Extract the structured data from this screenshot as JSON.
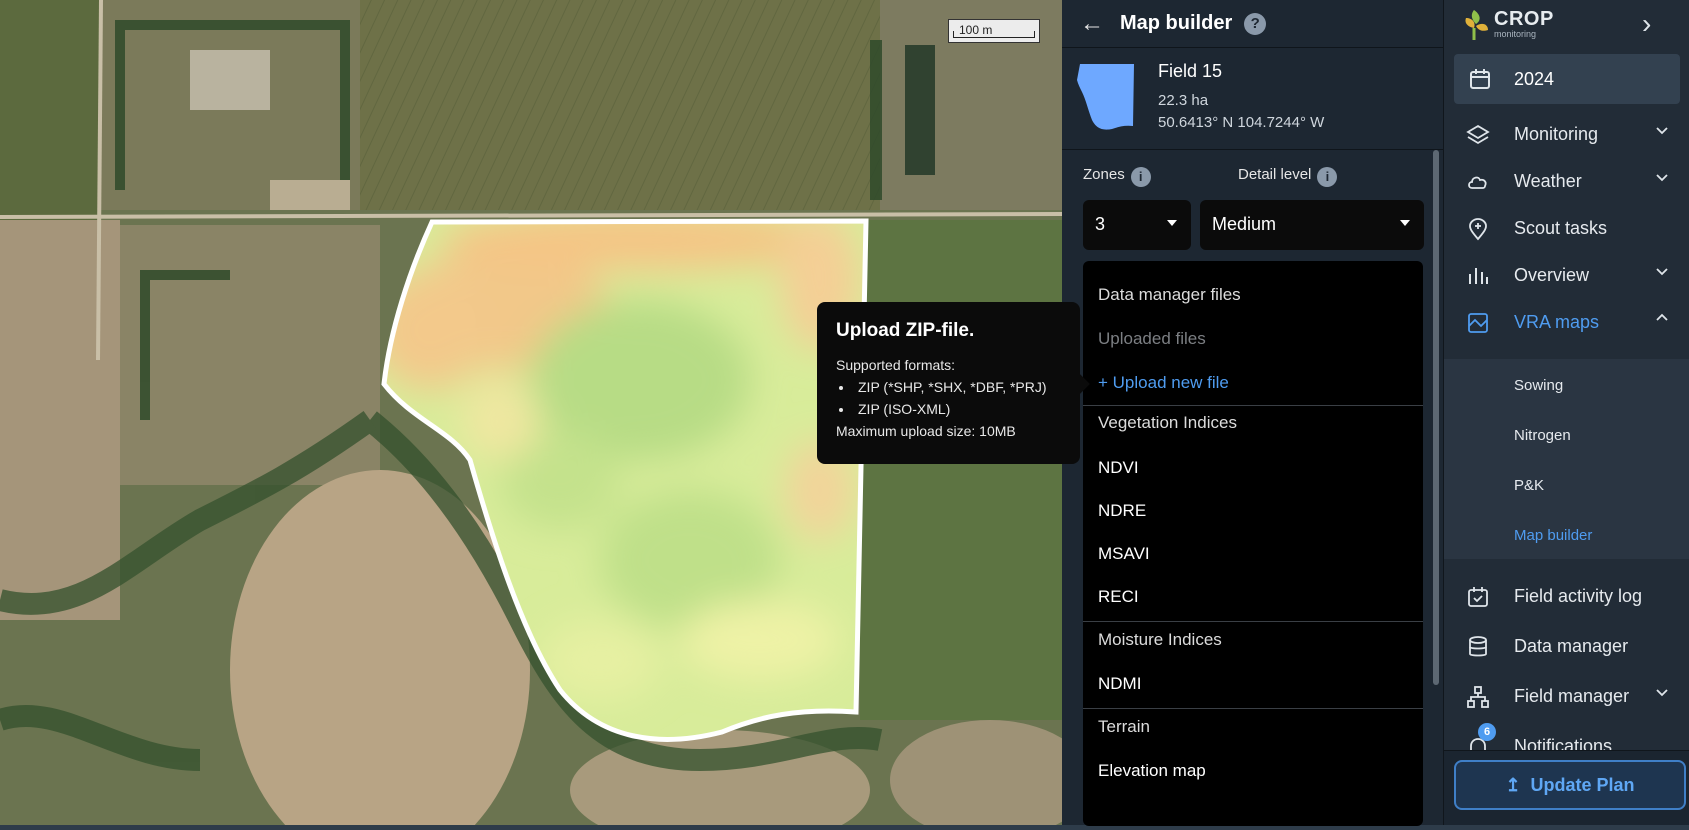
{
  "map": {
    "scale_label": "100 m"
  },
  "tooltip": {
    "title": "Upload ZIP-file.",
    "supported_label": "Supported formats:",
    "formats": [
      "ZIP (*SHP, *SHX, *DBF, *PRJ)",
      "ZIP (ISO-XML)"
    ],
    "max_size": "Maximum upload size: 10MB"
  },
  "panel": {
    "title": "Map builder",
    "help": "?",
    "field": {
      "name": "Field 15",
      "area": "22.3 ha",
      "coords": "50.6413° N 104.7244° W",
      "shape_color": "#6ea8ff"
    },
    "zones": {
      "label": "Zones",
      "value": "3"
    },
    "detail": {
      "label": "Detail level",
      "value": "Medium"
    },
    "dropdown": {
      "data_manager": "Data manager files",
      "uploaded": "Uploaded files",
      "upload_new": "+ Upload new file",
      "veg_header": "Vegetation Indices",
      "veg_items": [
        "NDVI",
        "NDRE",
        "MSAVI",
        "RECI"
      ],
      "moisture_header": "Moisture Indices",
      "moisture_items": [
        "NDMI"
      ],
      "terrain_header": "Terrain",
      "terrain_items": [
        "Elevation map"
      ]
    }
  },
  "nav": {
    "logo_text": "CROP",
    "logo_sub": "monitoring",
    "year": "2024",
    "items": {
      "monitoring": "Monitoring",
      "weather": "Weather",
      "scout": "Scout tasks",
      "overview": "Overview",
      "vra": "VRA maps",
      "activity": "Field activity log",
      "data_manager": "Data manager",
      "field_manager": "Field manager",
      "notifications": "Notifications"
    },
    "vra_sub": [
      "Sowing",
      "Nitrogen",
      "P&K",
      "Map builder"
    ],
    "notification_count": "6",
    "update_button": "Update Plan",
    "accent_color": "#4f9cf0"
  }
}
